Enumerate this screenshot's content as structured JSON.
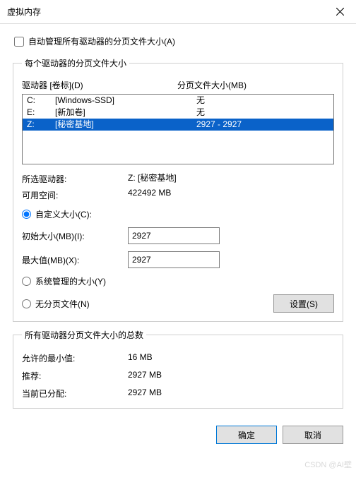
{
  "window": {
    "title": "虚拟内存"
  },
  "autoManage": {
    "label": "自动管理所有驱动器的分页文件大小(A)",
    "checked": false
  },
  "driveGroup": {
    "legend": "每个驱动器的分页文件大小",
    "header": {
      "driveCol": "驱动器 [卷标](D)",
      "sizeCol": "分页文件大小(MB)"
    },
    "rows": [
      {
        "letter": "C:",
        "label": "[Windows-SSD]",
        "size": "无",
        "selected": false
      },
      {
        "letter": "E:",
        "label": "[新加卷]",
        "size": "无",
        "selected": false
      },
      {
        "letter": "Z:",
        "label": "[秘密基地]",
        "size": "2927 - 2927",
        "selected": true
      }
    ],
    "selected": {
      "driveLabel": "所选驱动器:",
      "driveValue": "Z:  [秘密基地]",
      "freeLabel": "可用空间:",
      "freeValue": "422492 MB"
    },
    "customSize": {
      "radioLabel": "自定义大小(C):",
      "checked": true,
      "initial": {
        "label": "初始大小(MB)(I):",
        "value": "2927"
      },
      "max": {
        "label": "最大值(MB)(X):",
        "value": "2927"
      }
    },
    "systemManaged": {
      "radioLabel": "系统管理的大小(Y)",
      "checked": false
    },
    "noPaging": {
      "radioLabel": "无分页文件(N)",
      "checked": false
    },
    "setButton": "设置(S)"
  },
  "totals": {
    "legend": "所有驱动器分页文件大小的总数",
    "minAllowed": {
      "label": "允许的最小值:",
      "value": "16 MB"
    },
    "recommended": {
      "label": "推荐:",
      "value": "2927 MB"
    },
    "currently": {
      "label": "当前已分配:",
      "value": "2927 MB"
    }
  },
  "buttons": {
    "ok": "确定",
    "cancel": "取消"
  },
  "watermark": "CSDN @AI壁"
}
